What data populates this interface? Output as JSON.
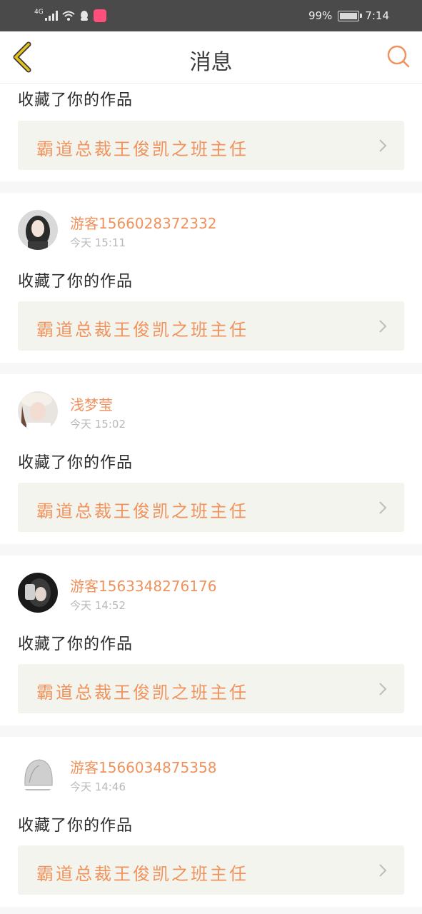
{
  "status_bar": {
    "network": "4G",
    "battery": "99%",
    "time": "7:14"
  },
  "header": {
    "title": "消息",
    "back_icon": "chevron-left-icon",
    "search_icon": "search-icon"
  },
  "colors": {
    "accent": "#f0925c",
    "back_icon": "#e6c31f",
    "card_bg": "#ffffff",
    "work_bg": "#f4f4ee",
    "page_bg": "#f7f7f7"
  },
  "notifications": [
    {
      "action": "收藏了你的作品",
      "work_title": "霸道总裁王俊凯之班主任"
    },
    {
      "username": "游客1566028372332",
      "time": "今天 15:11",
      "action": "收藏了你的作品",
      "work_title": "霸道总裁王俊凯之班主任"
    },
    {
      "username": "浅梦莹",
      "time": "今天 15:02",
      "action": "收藏了你的作品",
      "work_title": "霸道总裁王俊凯之班主任"
    },
    {
      "username": "游客1563348276176",
      "time": "今天 14:52",
      "action": "收藏了你的作品",
      "work_title": "霸道总裁王俊凯之班主任"
    },
    {
      "username": "游客1566034875358",
      "time": "今天 14:46",
      "action": "收藏了你的作品",
      "work_title": "霸道总裁王俊凯之班主任"
    }
  ]
}
